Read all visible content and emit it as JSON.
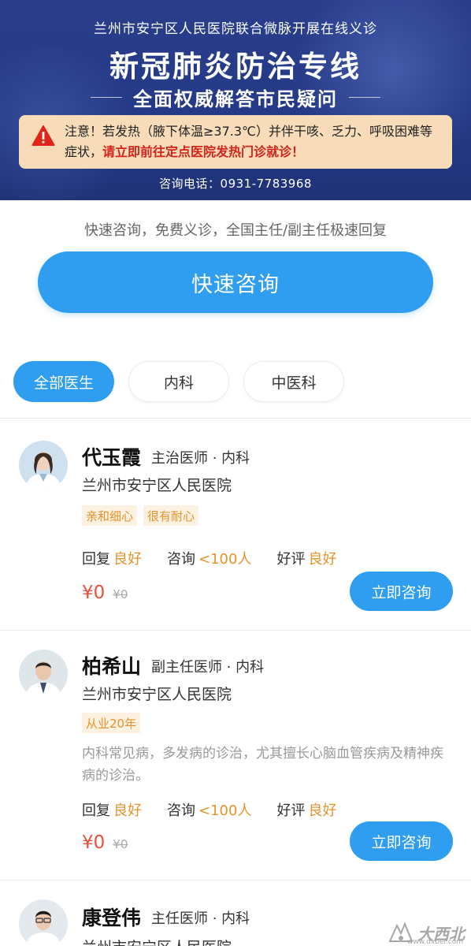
{
  "banner": {
    "subtitle": "兰州市安宁区人民医院联合微脉开展在线义诊",
    "title": "新冠肺炎防治专线",
    "slogan": "全面权威解答市民疑问",
    "notice_prefix": "注意！若发热（腋下体温≥37.3℃）并伴干咳、乏力、呼吸困难等症状，",
    "notice_red": "请立即前往定点医院发热门诊就诊！",
    "hotline": "咨询电话：0931-7783968",
    "warning_icon": "warning-triangle-icon"
  },
  "quick": {
    "description": "快速咨询，免费义诊，全国主任/副主任极速回复",
    "button_label": "快速咨询"
  },
  "filters": [
    "全部医生",
    "内科",
    "中医科"
  ],
  "doctors": [
    {
      "name": "代玉霞",
      "title": "主治医师 · 内科",
      "hospital": "兰州市安宁区人民医院",
      "tags": [
        "亲和细心",
        "很有耐心"
      ],
      "description": "",
      "stats": [
        {
          "label": "回复",
          "value": "良好"
        },
        {
          "label": "咨询",
          "value": "<100人"
        },
        {
          "label": "好评",
          "value": "良好"
        }
      ],
      "price": "¥0",
      "original_price": "¥0",
      "button_label": "立即咨询"
    },
    {
      "name": "柏希山",
      "title": "副主任医师 · 内科",
      "hospital": "兰州市安宁区人民医院",
      "tags": [
        "从业20年"
      ],
      "description": "内科常见病，多发病的诊治，尤其擅长心脑血管疾病及精神疾病的诊治。",
      "stats": [
        {
          "label": "回复",
          "value": "良好"
        },
        {
          "label": "咨询",
          "value": "<100人"
        },
        {
          "label": "好评",
          "value": "良好"
        }
      ],
      "price": "¥0",
      "original_price": "¥0",
      "button_label": "立即咨询"
    },
    {
      "name": "康登伟",
      "title": "主任医师 · 内科",
      "hospital": "兰州市安宁区人民医院",
      "tags": [],
      "description": "",
      "stats": [],
      "price": "",
      "original_price": "",
      "button_label": ""
    }
  ],
  "watermark": {
    "text": "大西北",
    "url": "www.dxbei.com"
  },
  "colors": {
    "accent": "#2f9ef0",
    "banner": "#253a86",
    "warning_red": "#d4231a",
    "tag_orange": "#e8922a",
    "price_red": "#e8503a"
  }
}
